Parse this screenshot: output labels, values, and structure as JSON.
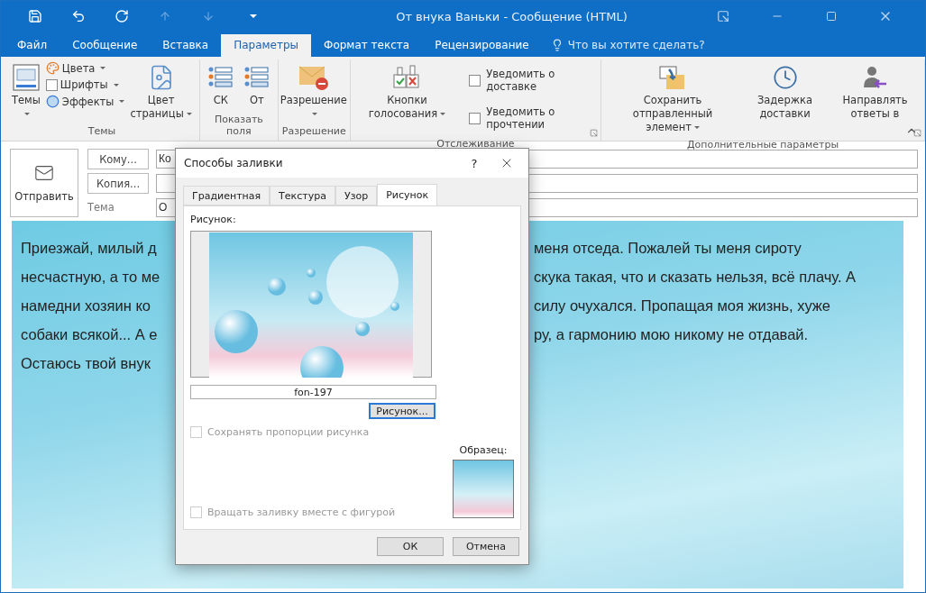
{
  "window": {
    "title": "От внука Ваньки - Сообщение (HTML)"
  },
  "menu_tabs": [
    {
      "label": "Файл",
      "selected": false
    },
    {
      "label": "Сообщение",
      "selected": false
    },
    {
      "label": "Вставка",
      "selected": false
    },
    {
      "label": "Параметры",
      "selected": true
    },
    {
      "label": "Формат текста",
      "selected": false
    },
    {
      "label": "Рецензирование",
      "selected": false
    }
  ],
  "tell_me": {
    "placeholder": "Что вы хотите сделать?"
  },
  "ribbon_groups": [
    {
      "title": "Темы",
      "launcher": false,
      "items": [
        {
          "kind": "large",
          "label": "Темы",
          "dropdown": true
        },
        {
          "kind": "stack",
          "entries": [
            {
              "label": "Цвета",
              "dropdown": true
            },
            {
              "label": "Шрифты",
              "dropdown": true
            },
            {
              "label": "Эффекты",
              "dropdown": true
            }
          ]
        },
        {
          "kind": "large",
          "label": "Цвет страницы",
          "dropdown": true
        }
      ]
    },
    {
      "title": "Показать поля",
      "launcher": false,
      "items": [
        {
          "kind": "large",
          "label": "СК",
          "dropdown": false
        },
        {
          "kind": "large",
          "label": "От",
          "dropdown": false
        }
      ]
    },
    {
      "title": "Разрешение",
      "launcher": false,
      "items": [
        {
          "kind": "large",
          "label": "Разрешение",
          "dropdown": true
        }
      ]
    },
    {
      "title": "Отслеживание",
      "launcher": true,
      "items": [
        {
          "kind": "large",
          "label": "Кнопки голосования",
          "dropdown": true
        },
        {
          "kind": "checks",
          "entries": [
            {
              "label": "Уведомить о доставке",
              "checked": false
            },
            {
              "label": "Уведомить о прочтении",
              "checked": false
            }
          ]
        }
      ]
    },
    {
      "title": "Дополнительные параметры",
      "launcher": true,
      "items": [
        {
          "kind": "large",
          "label": "Сохранить отправленный элемент",
          "dropdown": true
        },
        {
          "kind": "large",
          "label": "Задержка доставки",
          "dropdown": false
        },
        {
          "kind": "large",
          "label": "Направлять ответы в",
          "dropdown": false
        }
      ]
    }
  ],
  "compose": {
    "send": "Отправить",
    "to_button": "Кому...",
    "cc_button": "Копия...",
    "subject_label": "Тема",
    "to_value": "Ко",
    "subject_value": "О"
  },
  "body_lines": [
    {
      "left": "Приезжай, милый д",
      "right": "меня отседа. Пожалей ты меня сироту"
    },
    {
      "left": "несчастную, а то ме",
      "right": "скука такая, что и сказать нельзя, всё плачу. А"
    },
    {
      "left": "намедни хозяин ко",
      "right": "силу очухался. Пропащая моя жизнь, хуже"
    },
    {
      "left": "собаки всякой... А е",
      "right": "ру, а гармонию мою никому не отдавай."
    },
    {
      "left": "Остаюсь твой внук"
    }
  ],
  "dialog": {
    "title": "Способы заливки",
    "help": "?",
    "tabs": [
      {
        "label": "Градиентная",
        "selected": false
      },
      {
        "label": "Текстура",
        "selected": false
      },
      {
        "label": "Узор",
        "selected": false
      },
      {
        "label": "Рисунок",
        "selected": true
      }
    ],
    "picture_label": "Рисунок:",
    "file_name": "fon-197",
    "picture_button": "Рисунок...",
    "options": [
      {
        "label": "Сохранять пропорции рисунка",
        "checked": false,
        "disabled": true
      },
      {
        "label": "Вращать заливку вместе с фигурой",
        "checked": false,
        "disabled": true
      }
    ],
    "sample_label": "Образец:",
    "buttons": [
      "ОК",
      "Отмена"
    ]
  }
}
